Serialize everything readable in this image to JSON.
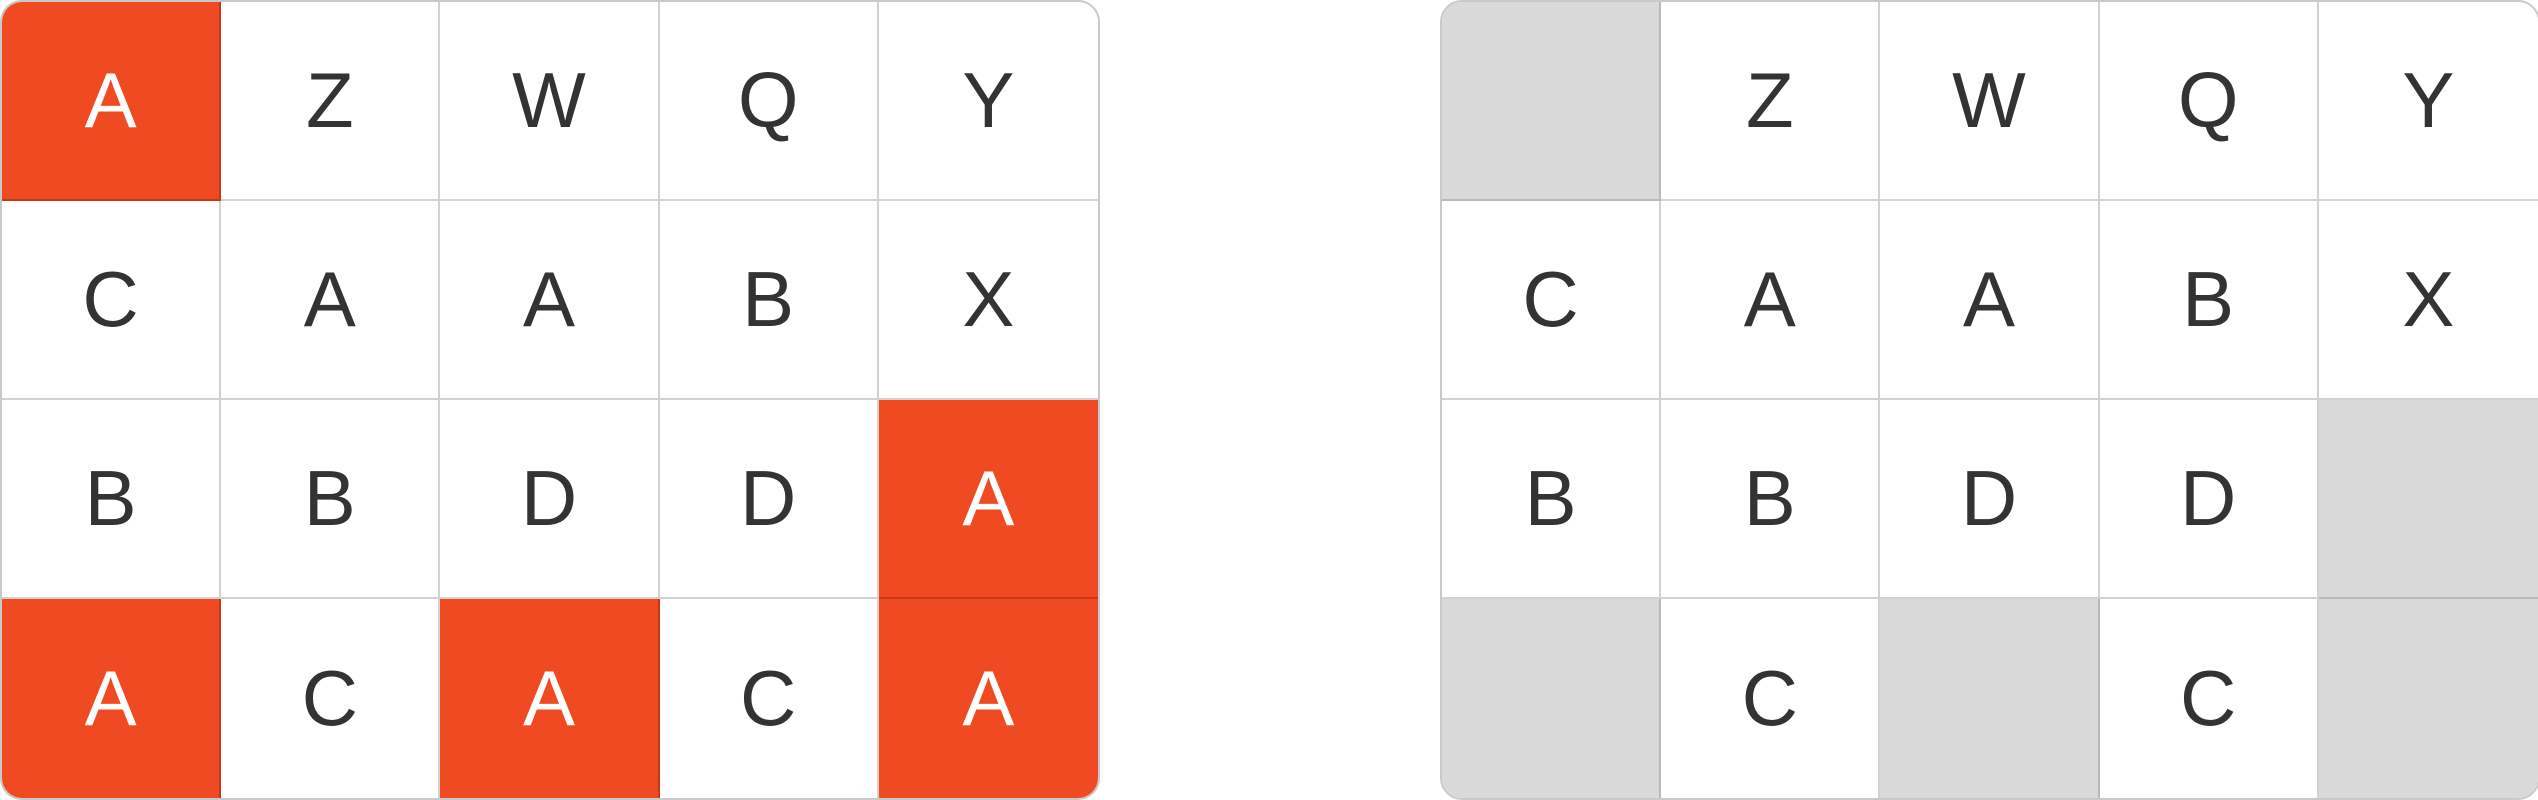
{
  "colors": {
    "highlight": "#f04a22",
    "removed": "#d9d9d9",
    "text": "#333333",
    "text_on_highlight": "#ffffff",
    "grid_line": "#d2d2d2"
  },
  "left_grid": {
    "rows": [
      [
        {
          "letter": "A",
          "state": "highlighted"
        },
        {
          "letter": "Z",
          "state": "normal"
        },
        {
          "letter": "W",
          "state": "normal"
        },
        {
          "letter": "Q",
          "state": "normal"
        },
        {
          "letter": "Y",
          "state": "normal"
        }
      ],
      [
        {
          "letter": "C",
          "state": "normal"
        },
        {
          "letter": "A",
          "state": "normal"
        },
        {
          "letter": "A",
          "state": "normal"
        },
        {
          "letter": "B",
          "state": "normal"
        },
        {
          "letter": "X",
          "state": "normal"
        }
      ],
      [
        {
          "letter": "B",
          "state": "normal"
        },
        {
          "letter": "B",
          "state": "normal"
        },
        {
          "letter": "D",
          "state": "normal"
        },
        {
          "letter": "D",
          "state": "normal"
        },
        {
          "letter": "A",
          "state": "highlighted"
        }
      ],
      [
        {
          "letter": "A",
          "state": "highlighted"
        },
        {
          "letter": "C",
          "state": "normal"
        },
        {
          "letter": "A",
          "state": "highlighted"
        },
        {
          "letter": "C",
          "state": "normal"
        },
        {
          "letter": "A",
          "state": "highlighted"
        }
      ]
    ]
  },
  "right_grid": {
    "rows": [
      [
        {
          "letter": "",
          "state": "removed"
        },
        {
          "letter": "Z",
          "state": "normal"
        },
        {
          "letter": "W",
          "state": "normal"
        },
        {
          "letter": "Q",
          "state": "normal"
        },
        {
          "letter": "Y",
          "state": "normal"
        }
      ],
      [
        {
          "letter": "C",
          "state": "normal"
        },
        {
          "letter": "A",
          "state": "normal"
        },
        {
          "letter": "A",
          "state": "normal"
        },
        {
          "letter": "B",
          "state": "normal"
        },
        {
          "letter": "X",
          "state": "normal"
        }
      ],
      [
        {
          "letter": "B",
          "state": "normal"
        },
        {
          "letter": "B",
          "state": "normal"
        },
        {
          "letter": "D",
          "state": "normal"
        },
        {
          "letter": "D",
          "state": "normal"
        },
        {
          "letter": "",
          "state": "removed"
        }
      ],
      [
        {
          "letter": "",
          "state": "removed"
        },
        {
          "letter": "C",
          "state": "normal"
        },
        {
          "letter": "",
          "state": "removed"
        },
        {
          "letter": "C",
          "state": "normal"
        },
        {
          "letter": "",
          "state": "removed"
        }
      ]
    ]
  }
}
